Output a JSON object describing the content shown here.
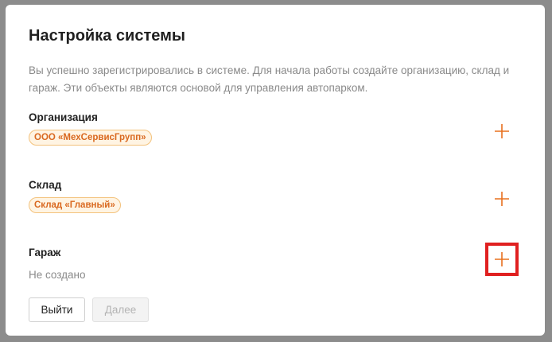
{
  "dialog": {
    "title": "Настройка системы",
    "description": "Вы успешно зарегистрировались в системе. Для начала работы создайте организацию, склад и гараж. Эти объекты являются основой для управления автопарком."
  },
  "sections": {
    "organization": {
      "label": "Организация",
      "tag": "ООО «МехСервисГрупп»",
      "add_icon": "plus-icon"
    },
    "warehouse": {
      "label": "Склад",
      "tag": "Склад «Главный»",
      "add_icon": "plus-icon"
    },
    "garage": {
      "label": "Гараж",
      "empty_text": "Не создано",
      "add_icon": "plus-icon"
    }
  },
  "footer": {
    "exit_label": "Выйти",
    "next_label": "Далее"
  },
  "colors": {
    "accent": "#e8701e",
    "tag_text": "#d9681f",
    "tag_bg": "#fff4e3",
    "tag_border": "#f3c27c",
    "highlight": "#e02020"
  }
}
